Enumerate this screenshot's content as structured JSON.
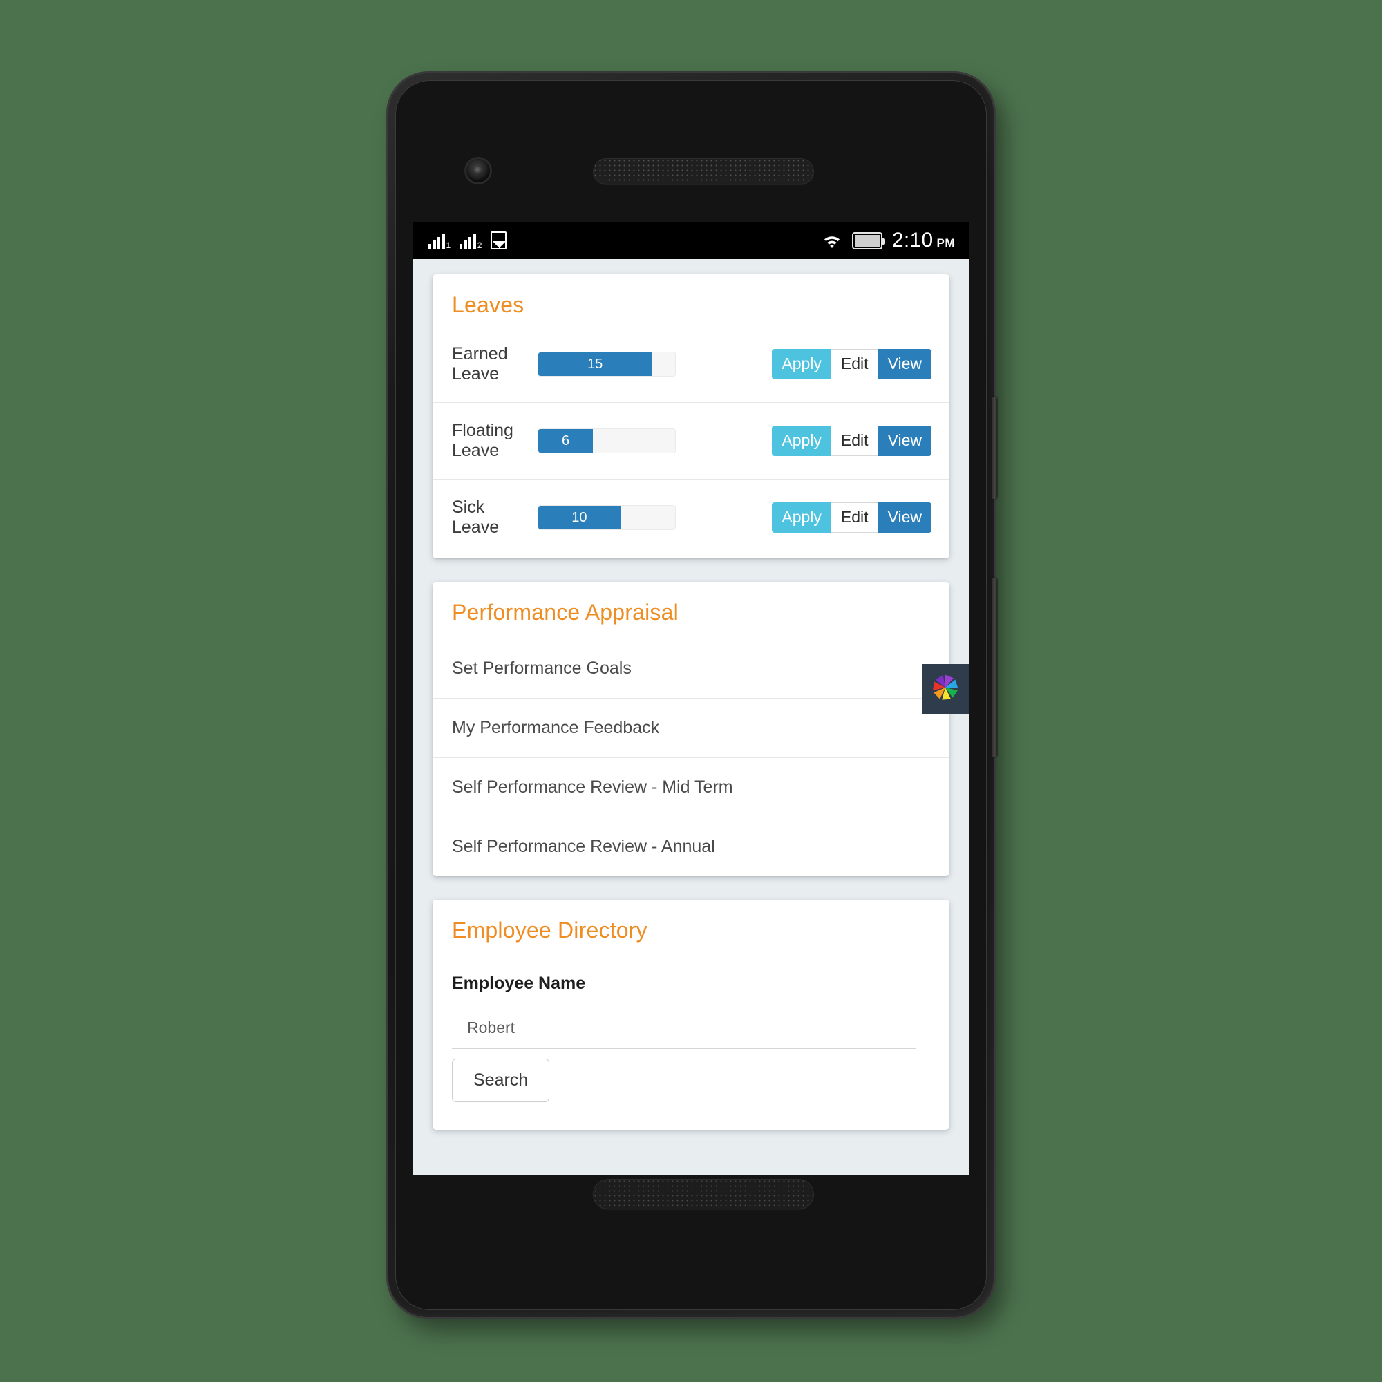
{
  "status_bar": {
    "signal_1_label": "1",
    "signal_2_label": "2",
    "image_icon": "image-icon",
    "wifi_icon": "wifi-icon",
    "battery_icon": "battery-icon",
    "time": "2:10",
    "time_suffix": "PM"
  },
  "colors": {
    "accent_orange": "#ef8d22",
    "progress_blue": "#2a7fba",
    "apply_cyan": "#4ec3e0",
    "view_blue": "#2a7fba",
    "app_background": "#e8edf0",
    "desktop_background": "#4c724d"
  },
  "leaves_card": {
    "title": "Leaves",
    "buttons": {
      "apply": "Apply",
      "edit": "Edit",
      "view": "View"
    },
    "rows": [
      {
        "label": "Earned Leave",
        "value": "15",
        "percent": 83
      },
      {
        "label": "Floating Leave",
        "value": "6",
        "percent": 40
      },
      {
        "label": "Sick Leave",
        "value": "10",
        "percent": 60
      }
    ]
  },
  "performance_card": {
    "title": "Performance Appraisal",
    "items": [
      "Set Performance Goals",
      "My Performance Feedback",
      "Self Performance Review - Mid Term",
      "Self Performance Review - Annual"
    ]
  },
  "employee_directory_card": {
    "title": "Employee Directory",
    "name_label": "Employee Name",
    "name_value": "Robert",
    "name_placeholder": "",
    "search_label": "Search"
  },
  "floating_launcher": {
    "icon": "colorful-pinwheel-star-icon"
  }
}
